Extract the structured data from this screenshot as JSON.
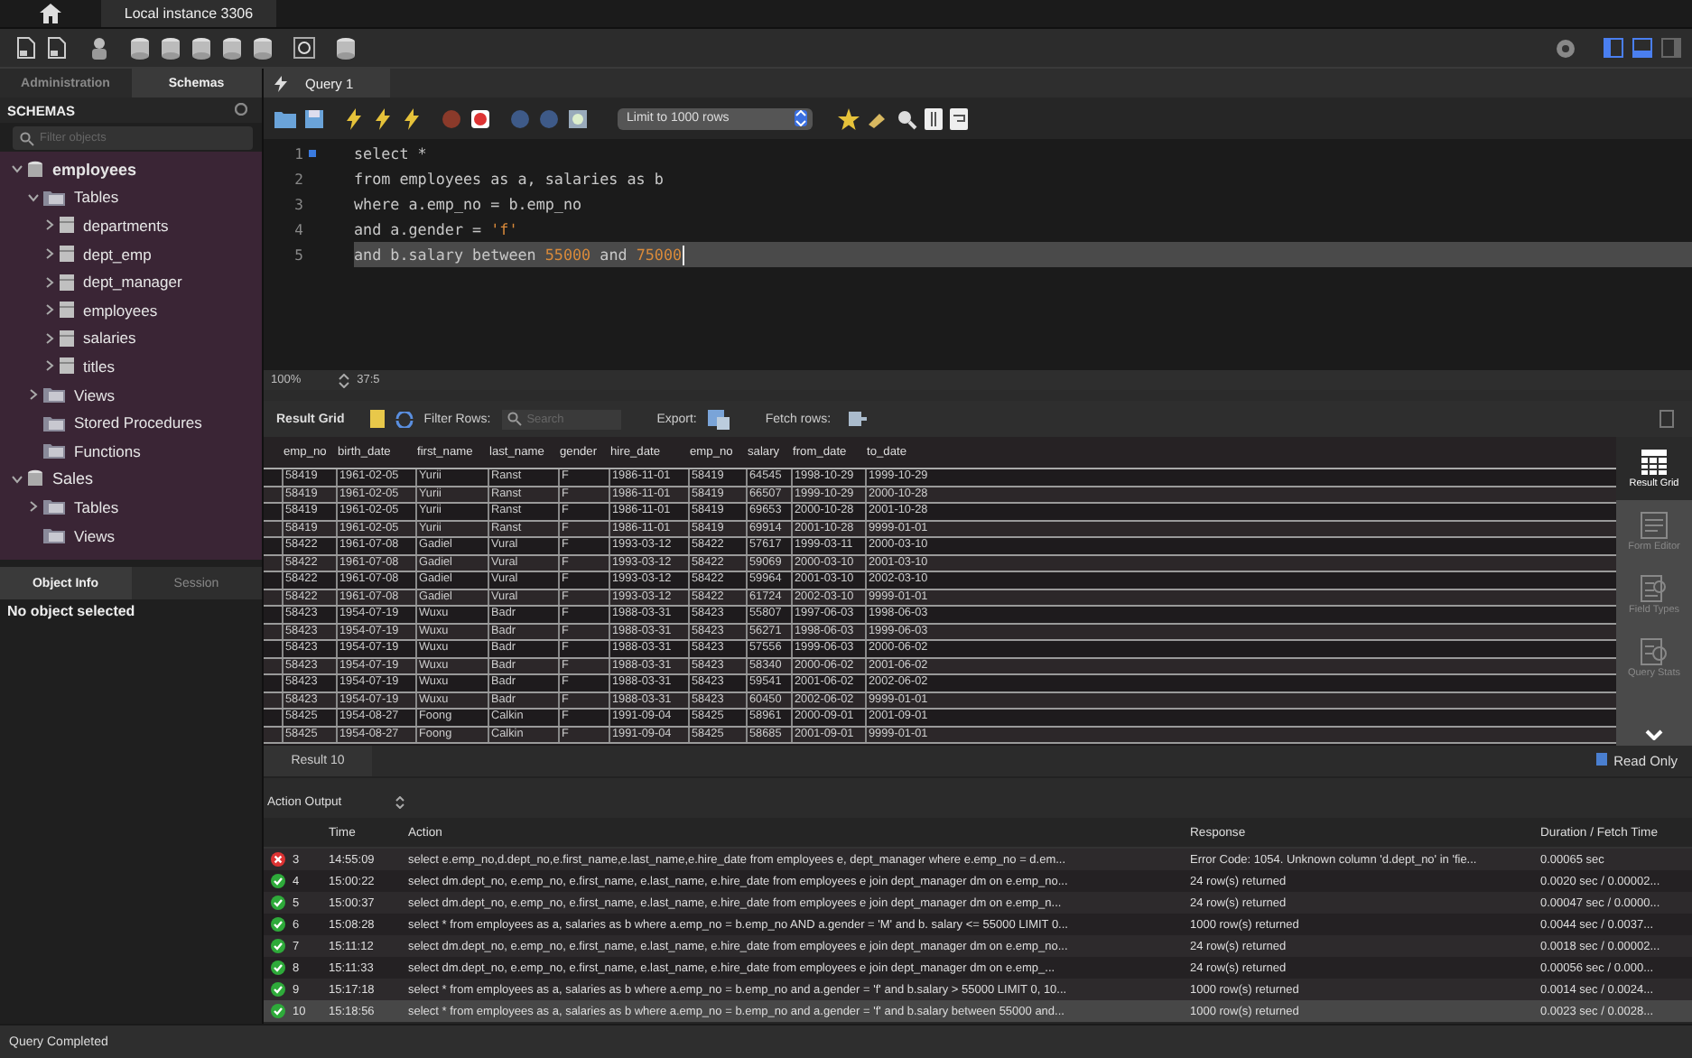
{
  "instance_tab": {
    "label": "Local instance 3306"
  },
  "layout_toggles": [
    {
      "on": true
    },
    {
      "on": true
    },
    {
      "on": false
    }
  ],
  "sidebar": {
    "tabs": [
      {
        "label": "Administration",
        "selected": false
      },
      {
        "label": "Schemas",
        "selected": true
      }
    ],
    "title": "SCHEMAS",
    "filter": {
      "placeholder": "Filter objects"
    },
    "tree": [
      {
        "label": "employees",
        "kind": "schema",
        "expanded": true,
        "default_schema": true,
        "children": [
          {
            "label": "Tables",
            "kind": "folder",
            "expanded": true,
            "children": [
              {
                "label": "departments",
                "kind": "table",
                "expanded": false
              },
              {
                "label": "dept_emp",
                "kind": "table",
                "expanded": false
              },
              {
                "label": "dept_manager",
                "kind": "table",
                "expanded": false
              },
              {
                "label": "employees",
                "kind": "table",
                "expanded": false
              },
              {
                "label": "salaries",
                "kind": "table",
                "expanded": false
              },
              {
                "label": "titles",
                "kind": "table",
                "expanded": false
              }
            ]
          },
          {
            "label": "Views",
            "kind": "folder",
            "expanded": false
          },
          {
            "label": "Stored Procedures",
            "kind": "folder"
          },
          {
            "label": "Functions",
            "kind": "folder"
          }
        ]
      },
      {
        "label": "Sales",
        "kind": "schema",
        "expanded": true,
        "default_schema": false,
        "children": [
          {
            "label": "Tables",
            "kind": "folder",
            "expanded": false
          },
          {
            "label": "Views",
            "kind": "folder"
          }
        ]
      }
    ],
    "info_tabs": [
      {
        "label": "Object Info",
        "selected": true
      },
      {
        "label": "Session",
        "selected": false
      }
    ],
    "info_text": "No object selected"
  },
  "query_tab": {
    "label": "Query 1"
  },
  "limit_select": {
    "value": "Limit to 1000 rows"
  },
  "editor": {
    "lines": [
      {
        "number": "1",
        "marker": true,
        "current": false,
        "tokens": [
          {
            "text": "select *",
            "kind": "code"
          }
        ]
      },
      {
        "number": "2",
        "marker": false,
        "current": false,
        "tokens": [
          {
            "text": "from employees as a, salaries as b",
            "kind": "code"
          }
        ]
      },
      {
        "number": "3",
        "marker": false,
        "current": false,
        "tokens": [
          {
            "text": "where a.emp_no = b.emp_no",
            "kind": "code"
          }
        ]
      },
      {
        "number": "4",
        "marker": false,
        "current": false,
        "tokens": [
          {
            "text": "and a.gender = ",
            "kind": "code"
          },
          {
            "text": "'f'",
            "kind": "literal"
          }
        ]
      },
      {
        "number": "5",
        "marker": false,
        "current": true,
        "tokens": [
          {
            "text": "and b.salary between ",
            "kind": "code"
          },
          {
            "text": "55000",
            "kind": "literal"
          },
          {
            "text": " and ",
            "kind": "code"
          },
          {
            "text": "75000",
            "kind": "literal"
          }
        ]
      }
    ],
    "zoom": "100%",
    "cursor": "37:5"
  },
  "results": {
    "title": "Result Grid",
    "filter_label": "Filter Rows:",
    "search": {
      "placeholder": "Search"
    },
    "export_label": "Export:",
    "fetch_label": "Fetch rows:",
    "columns": [
      "emp_no",
      "birth_date",
      "first_name",
      "last_name",
      "gender",
      "hire_date",
      "emp_no",
      "salary",
      "from_date",
      "to_date"
    ],
    "rows": [
      [
        "58419",
        "1961-02-05",
        "Yurii",
        "Ranst",
        "F",
        "1986-11-01",
        "58419",
        "64545",
        "1998-10-29",
        "1999-10-29"
      ],
      [
        "58419",
        "1961-02-05",
        "Yurii",
        "Ranst",
        "F",
        "1986-11-01",
        "58419",
        "66507",
        "1999-10-29",
        "2000-10-28"
      ],
      [
        "58419",
        "1961-02-05",
        "Yurii",
        "Ranst",
        "F",
        "1986-11-01",
        "58419",
        "69653",
        "2000-10-28",
        "2001-10-28"
      ],
      [
        "58419",
        "1961-02-05",
        "Yurii",
        "Ranst",
        "F",
        "1986-11-01",
        "58419",
        "69914",
        "2001-10-28",
        "9999-01-01"
      ],
      [
        "58422",
        "1961-07-08",
        "Gadiel",
        "Vural",
        "F",
        "1993-03-12",
        "58422",
        "57617",
        "1999-03-11",
        "2000-03-10"
      ],
      [
        "58422",
        "1961-07-08",
        "Gadiel",
        "Vural",
        "F",
        "1993-03-12",
        "58422",
        "59069",
        "2000-03-10",
        "2001-03-10"
      ],
      [
        "58422",
        "1961-07-08",
        "Gadiel",
        "Vural",
        "F",
        "1993-03-12",
        "58422",
        "59964",
        "2001-03-10",
        "2002-03-10"
      ],
      [
        "58422",
        "1961-07-08",
        "Gadiel",
        "Vural",
        "F",
        "1993-03-12",
        "58422",
        "61724",
        "2002-03-10",
        "9999-01-01"
      ],
      [
        "58423",
        "1954-07-19",
        "Wuxu",
        "Badr",
        "F",
        "1988-03-31",
        "58423",
        "55807",
        "1997-06-03",
        "1998-06-03"
      ],
      [
        "58423",
        "1954-07-19",
        "Wuxu",
        "Badr",
        "F",
        "1988-03-31",
        "58423",
        "56271",
        "1998-06-03",
        "1999-06-03"
      ],
      [
        "58423",
        "1954-07-19",
        "Wuxu",
        "Badr",
        "F",
        "1988-03-31",
        "58423",
        "57556",
        "1999-06-03",
        "2000-06-02"
      ],
      [
        "58423",
        "1954-07-19",
        "Wuxu",
        "Badr",
        "F",
        "1988-03-31",
        "58423",
        "58340",
        "2000-06-02",
        "2001-06-02"
      ],
      [
        "58423",
        "1954-07-19",
        "Wuxu",
        "Badr",
        "F",
        "1988-03-31",
        "58423",
        "59541",
        "2001-06-02",
        "2002-06-02"
      ],
      [
        "58423",
        "1954-07-19",
        "Wuxu",
        "Badr",
        "F",
        "1988-03-31",
        "58423",
        "60450",
        "2002-06-02",
        "9999-01-01"
      ],
      [
        "58425",
        "1954-08-27",
        "Foong",
        "Calkin",
        "F",
        "1991-09-04",
        "58425",
        "58961",
        "2000-09-01",
        "2001-09-01"
      ],
      [
        "58425",
        "1954-08-27",
        "Foong",
        "Calkin",
        "F",
        "1991-09-04",
        "58425",
        "58685",
        "2001-09-01",
        "9999-01-01"
      ]
    ],
    "views": [
      {
        "label": "Result Grid",
        "selected": true
      },
      {
        "label": "Form Editor",
        "selected": false
      },
      {
        "label": "Field Types",
        "selected": false
      },
      {
        "label": "Query Stats",
        "selected": false
      }
    ],
    "result_tab": "Result 10",
    "read_only": "Read Only"
  },
  "output": {
    "selector": "Action Output",
    "columns": [
      "Time",
      "Action",
      "Response",
      "Duration / Fetch Time"
    ],
    "rows": [
      {
        "failed": true,
        "number": "3",
        "time": "14:55:09",
        "action": "select e.emp_no,d.dept_no,e.first_name,e.last_name,e.hire_date from employees e, dept_manager where e.emp_no = d.em...",
        "response": "Error Code: 1054. Unknown column 'd.dept_no' in 'fie...",
        "duration": "0.00065 sec",
        "selected": false
      },
      {
        "failed": false,
        "number": "4",
        "time": "15:00:22",
        "action": "select dm.dept_no, e.emp_no, e.first_name, e.last_name, e.hire_date from employees e join dept_manager dm on e.emp_no...",
        "response": "24 row(s) returned",
        "duration": "0.0020 sec / 0.00002...",
        "selected": false
      },
      {
        "failed": false,
        "number": "5",
        "time": "15:00:37",
        "action": "select dm.dept_no, e.emp_no, e.first_name, e.last_name, e.hire_date from employees e join dept_manager dm on e.emp_n...",
        "response": "24 row(s) returned",
        "duration": "0.00047 sec / 0.0000...",
        "selected": false
      },
      {
        "failed": false,
        "number": "6",
        "time": "15:08:28",
        "action": "select * from employees as a, salaries as b where a.emp_no = b.emp_no AND a.gender = 'M' and b. salary <= 55000 LIMIT 0...",
        "response": "1000 row(s) returned",
        "duration": "0.0044 sec / 0.0037...",
        "selected": false
      },
      {
        "failed": false,
        "number": "7",
        "time": "15:11:12",
        "action": "select dm.dept_no, e.emp_no, e.first_name, e.last_name, e.hire_date from employees e join dept_manager dm on e.emp_no...",
        "response": "24 row(s) returned",
        "duration": "0.0018 sec / 0.00002...",
        "selected": false
      },
      {
        "failed": false,
        "number": "8",
        "time": "15:11:33",
        "action": "select dm.dept_no, e.emp_no, e.first_name, e.last_name, e.hire_date from employees e join dept_manager dm on e.emp_...",
        "response": "24 row(s) returned",
        "duration": "0.00056 sec / 0.000...",
        "selected": false
      },
      {
        "failed": false,
        "number": "9",
        "time": "15:17:18",
        "action": "select * from employees as a, salaries as b where a.emp_no = b.emp_no and a.gender = 'f' and b.salary > 55000 LIMIT 0, 10...",
        "response": "1000 row(s) returned",
        "duration": "0.0014 sec / 0.0024...",
        "selected": false
      },
      {
        "failed": false,
        "number": "10",
        "time": "15:18:56",
        "action": "select * from employees as a, salaries as b where a.emp_no = b.emp_no and a.gender = 'f' and b.salary between 55000 and...",
        "response": "1000 row(s) returned",
        "duration": "0.0023 sec / 0.0028...",
        "selected": true
      }
    ]
  },
  "status_bar": "Query Completed"
}
